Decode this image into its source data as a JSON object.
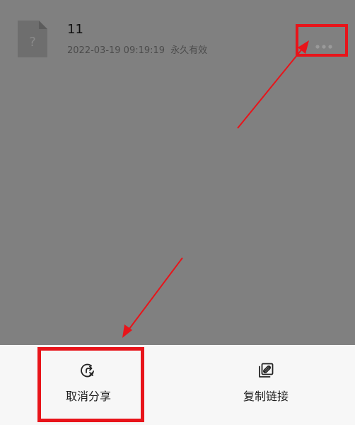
{
  "file": {
    "name": "11",
    "date": "2022-03-19 09:19:19",
    "validity": "永久有效",
    "icon": "unknown-file-icon"
  },
  "more_button": {
    "icon": "more-dots-icon"
  },
  "action_sheet": {
    "cancel_share": {
      "label": "取消分享",
      "icon": "cancel-share-icon"
    },
    "copy_link": {
      "label": "复制链接",
      "icon": "copy-link-icon"
    }
  },
  "colors": {
    "annotation_red": "#e8141a",
    "overlay_gray": "#808080",
    "sheet_background": "#f7f7f7"
  }
}
